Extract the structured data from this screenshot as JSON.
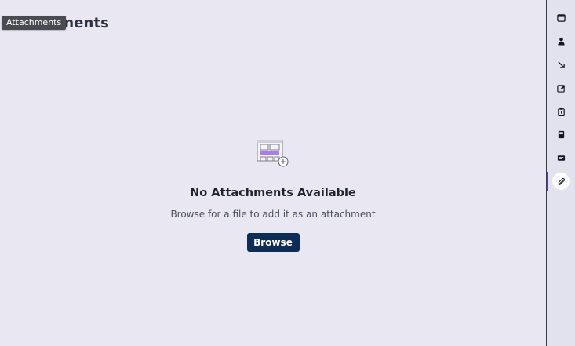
{
  "tooltip": {
    "text": "Attachments"
  },
  "header": {
    "title": "Attachments"
  },
  "empty_state": {
    "title": "No Attachments Available",
    "description": "Browse for a file to add it as an attachment",
    "button_label": "Browse"
  },
  "sidebar": {
    "items": [
      {
        "icon": "calendar-icon"
      },
      {
        "icon": "user-icon"
      },
      {
        "icon": "arrow-down-right-icon"
      },
      {
        "icon": "edit-icon"
      },
      {
        "icon": "clipboard-icon"
      },
      {
        "icon": "book-icon"
      },
      {
        "icon": "card-icon"
      },
      {
        "icon": "paperclip-icon",
        "active": true
      }
    ]
  },
  "colors": {
    "background": "#e9e8f2",
    "rail": "#e2e1ee",
    "primary_button": "#0e2d56",
    "active_indicator": "#5a3aa8",
    "illustration_accent": "#a97ee6"
  }
}
